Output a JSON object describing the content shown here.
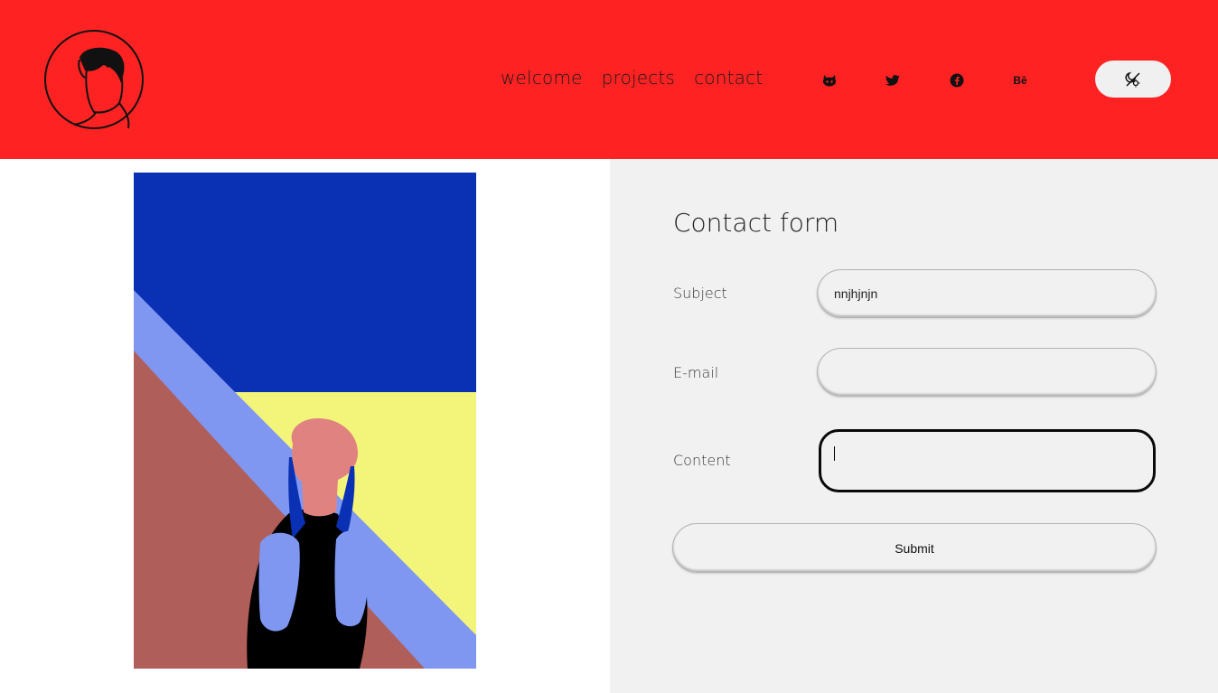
{
  "colors": {
    "header_bg": "#ff2222",
    "form_panel_bg": "#f1f1f1",
    "art_blue": "#0a31b3",
    "art_light_blue": "#7f97f1",
    "art_yellow": "#f3f47a",
    "art_brown": "#b05e5a",
    "art_skin": "#e08380"
  },
  "header": {
    "logo_icon": "avatar-logo",
    "nav": {
      "welcome": "welcome",
      "projects": "projects",
      "contact": "contact"
    },
    "social": {
      "github_icon": "github-icon",
      "twitter_icon": "twitter-icon",
      "facebook_icon": "facebook-icon",
      "behance_label": "Bē"
    },
    "theme_toggle_icon": "theme-toggle-icon"
  },
  "contact_form": {
    "title": "Contact form",
    "subject_label": "Subject",
    "subject_value": "nnjhjnjn",
    "email_label": "E-mail",
    "email_value": "",
    "content_label": "Content",
    "content_value": "",
    "submit_label": "Submit"
  }
}
